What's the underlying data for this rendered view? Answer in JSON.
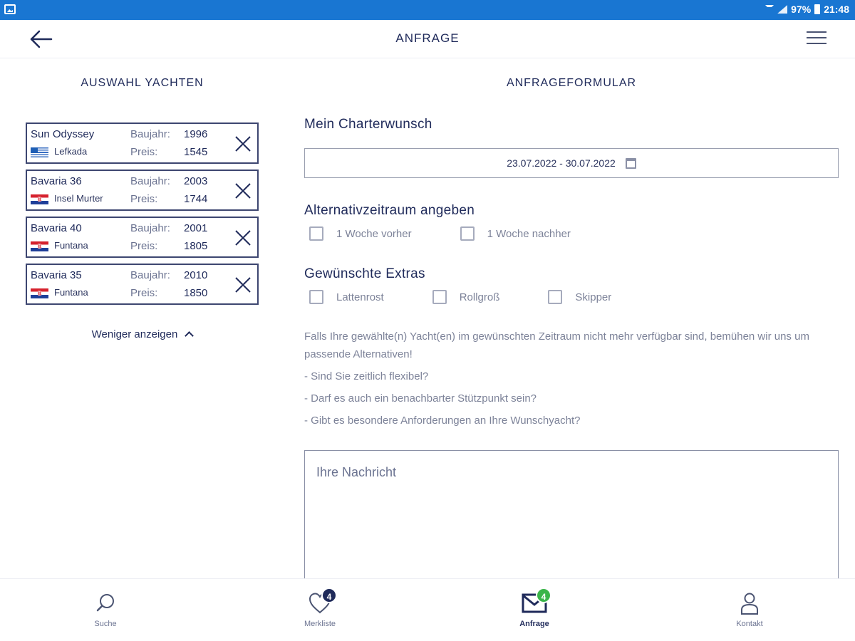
{
  "status_bar": {
    "battery": "97%",
    "time": "21:48"
  },
  "header": {
    "title": "ANFRAGE",
    "back_icon": "arrow-left-icon",
    "menu_icon": "hamburger-menu-icon"
  },
  "left": {
    "title": "AUSWAHL YACHTEN",
    "yachts": [
      {
        "name": "Sun Odyssey",
        "location": "Lefkada",
        "flag": "greece-flag",
        "year_label": "Baujahr:",
        "year": "1996",
        "price_label": "Preis:",
        "price": "1545"
      },
      {
        "name": "Bavaria 36",
        "location": "Insel Murter",
        "flag": "croatia-flag",
        "year_label": "Baujahr:",
        "year": "2003",
        "price_label": "Preis:",
        "price": "1744"
      },
      {
        "name": "Bavaria 40",
        "location": "Funtana",
        "flag": "croatia-flag",
        "year_label": "Baujahr:",
        "year": "2001",
        "price_label": "Preis:",
        "price": "1805"
      },
      {
        "name": "Bavaria 35",
        "location": "Funtana",
        "flag": "croatia-flag",
        "year_label": "Baujahr:",
        "year": "2010",
        "price_label": "Preis:",
        "price": "1850"
      }
    ],
    "show_less": "Weniger anzeigen"
  },
  "form": {
    "title": "ANFRAGEFORMULAR",
    "charter_title": "Mein Charterwunsch",
    "date_range": "23.07.2022 - 30.07.2022",
    "alt_title": "Alternativzeitraum angeben",
    "alt_options": [
      "1 Woche vorher",
      "1 Woche nachher"
    ],
    "extras_title": "Gewünschte Extras",
    "extras_options": [
      "Lattenrost",
      "Rollgroß",
      "Skipper"
    ],
    "info_lines": [
      "Falls Ihre gewählte(n) Yacht(en) im gewünschten Zeitraum nicht mehr verfügbar sind, bemühen wir uns um passende Alternativen!",
      "- Sind Sie zeitlich flexibel?",
      "- Darf es auch ein benachbarter Stützpunkt sein?",
      "- Gibt es besondere Anforderungen an Ihre Wunschyacht?"
    ],
    "message_placeholder": "Ihre Nachricht"
  },
  "bottom_nav": [
    {
      "label": "Suche",
      "icon": "search-icon",
      "active": false
    },
    {
      "label": "Merkliste",
      "icon": "heart-icon",
      "badge": "4",
      "active": false
    },
    {
      "label": "Anfrage",
      "icon": "mail-icon",
      "badge": "4",
      "active": true
    },
    {
      "label": "Kontakt",
      "icon": "person-icon",
      "active": false
    }
  ],
  "colors": {
    "status_bar": "#1976d2",
    "primary": "#1f2a5a",
    "badge_green": "#3bb54a"
  }
}
